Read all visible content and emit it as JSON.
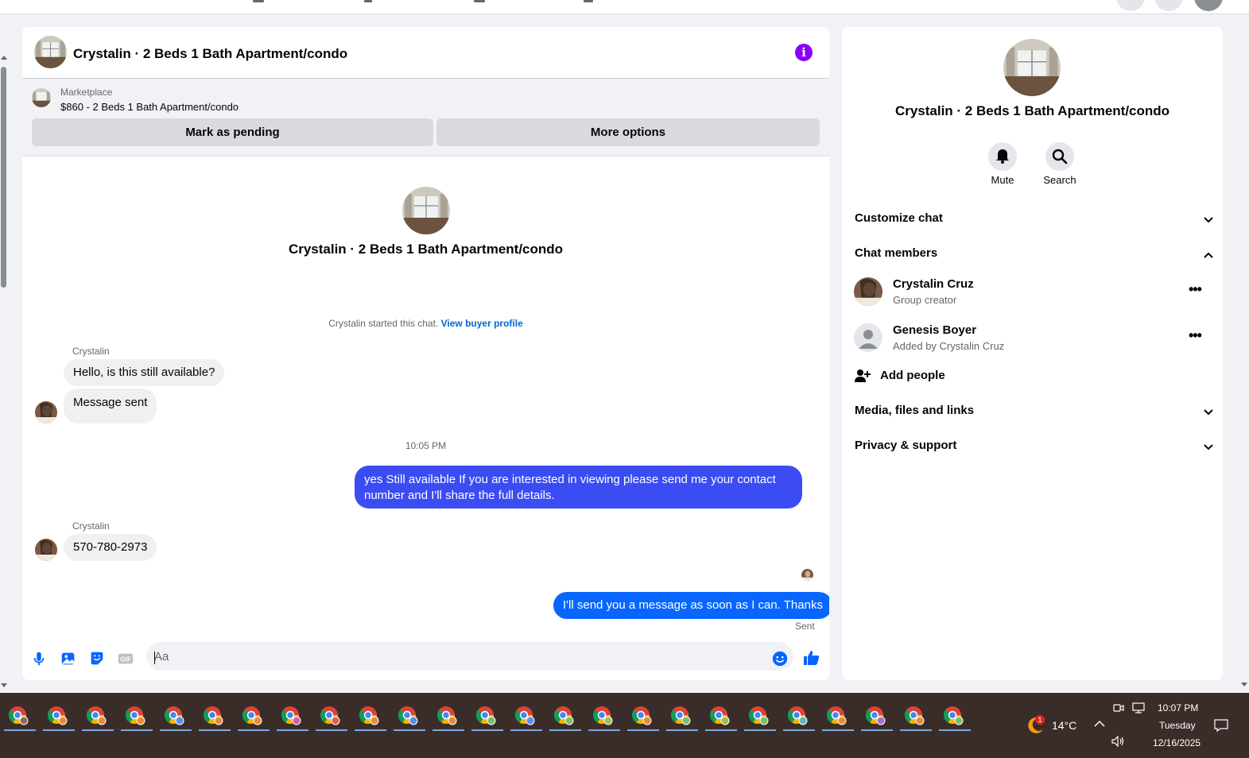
{
  "chat": {
    "title": "Crystalin · 2 Beds 1 Bath Apartment/condo",
    "info_icon": "i",
    "listing": {
      "source": "Marketplace",
      "price_title": "$860 - 2 Beds 1 Bath Apartment/condo",
      "mark_pending": "Mark as pending",
      "more_options": "More options"
    },
    "intro_title": "Crystalin · 2 Beds 1 Bath Apartment/condo",
    "started_text": "Crystalin started this chat.",
    "view_profile": "View buyer profile",
    "messages": [
      {
        "sender": "Crystalin",
        "text": "Hello, is this still available?"
      },
      {
        "text": "Message sent"
      },
      {
        "time": "10:05 PM"
      },
      {
        "text": "yes Still available If you are interested in viewing please send me your contact number and I'll share the full details."
      },
      {
        "sender": "Crystalin",
        "text": "570-780-2973"
      },
      {
        "text": "I'll send you a message as soon as I can. Thanks"
      }
    ],
    "sent_status": "Sent",
    "composer_placeholder": "Aa"
  },
  "side": {
    "title": "Crystalin · 2 Beds 1 Bath Apartment/condo",
    "mute_label": "Mute",
    "search_label": "Search",
    "customize_chat": "Customize chat",
    "chat_members": "Chat members",
    "members": [
      {
        "name": "Crystalin Cruz",
        "sub": "Group creator"
      },
      {
        "name": "Genesis Boyer",
        "sub": "Added by Crystalin Cruz"
      }
    ],
    "add_people": "Add people",
    "media_files": "Media, files and links",
    "privacy": "Privacy & support"
  },
  "taskbar": {
    "temperature": "14°C",
    "time": "10:07 PM",
    "day": "Tuesday",
    "date": "12/16/2025",
    "weather_badge": "1"
  },
  "colors": {
    "accent_blue": "#0064d1",
    "outgoing_gradient_top": "#3d4bf5",
    "outgoing_bubble": "#0866ff",
    "info_purple": "#8a00ff"
  }
}
